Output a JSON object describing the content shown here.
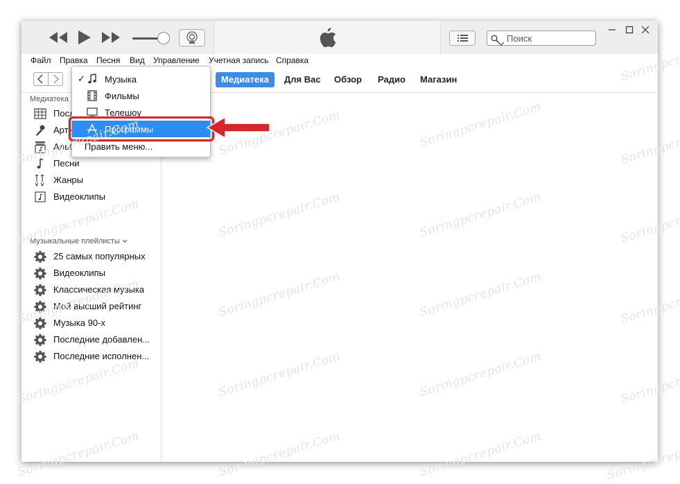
{
  "watermark": "Soringpcrepair.Com",
  "menubar": {
    "items": [
      "Файл",
      "Правка",
      "Песня",
      "Вид",
      "Управление",
      "Учетная запись",
      "Справка"
    ]
  },
  "search": {
    "placeholder": "Поиск"
  },
  "tabs": {
    "library": "Медиатека",
    "for_you": "Для Вас",
    "browse": "Обзор",
    "radio": "Радио",
    "store": "Магазин"
  },
  "sidebar": {
    "library_heading": "Медиатека",
    "library_items": [
      {
        "label": "Последние добавленные",
        "icon": "grid-icon"
      },
      {
        "label": "Артисты",
        "icon": "microphone-icon"
      },
      {
        "label": "Альбомы",
        "icon": "album-icon"
      },
      {
        "label": "Песни",
        "icon": "music-note-icon"
      },
      {
        "label": "Жанры",
        "icon": "guitar-icon"
      },
      {
        "label": "Видеоклипы",
        "icon": "video-clip-icon"
      }
    ],
    "playlists_heading": "Музыкальные плейлисты",
    "playlists": [
      "25 самых популярных",
      "Видеоклипы",
      "Классическая музыка",
      "Мой высший рейтинг",
      "Музыка 90-х",
      "Последние добавлен...",
      "Последние исполнен..."
    ]
  },
  "media_menu": {
    "items": [
      {
        "label": "Музыка",
        "checked": true,
        "icon": "music-note-icon"
      },
      {
        "label": "Фильмы",
        "checked": false,
        "icon": "film-icon"
      },
      {
        "label": "Телешоу",
        "checked": false,
        "icon": "tv-icon"
      },
      {
        "label": "Программы",
        "checked": false,
        "icon": "app-store-icon",
        "highlighted": true
      }
    ],
    "checkmark": "✓",
    "edit_label": "Править меню..."
  },
  "colors": {
    "accent": "#3a8ce8",
    "menu_highlight": "#2e8df2",
    "annotation_red": "#d4262b"
  }
}
